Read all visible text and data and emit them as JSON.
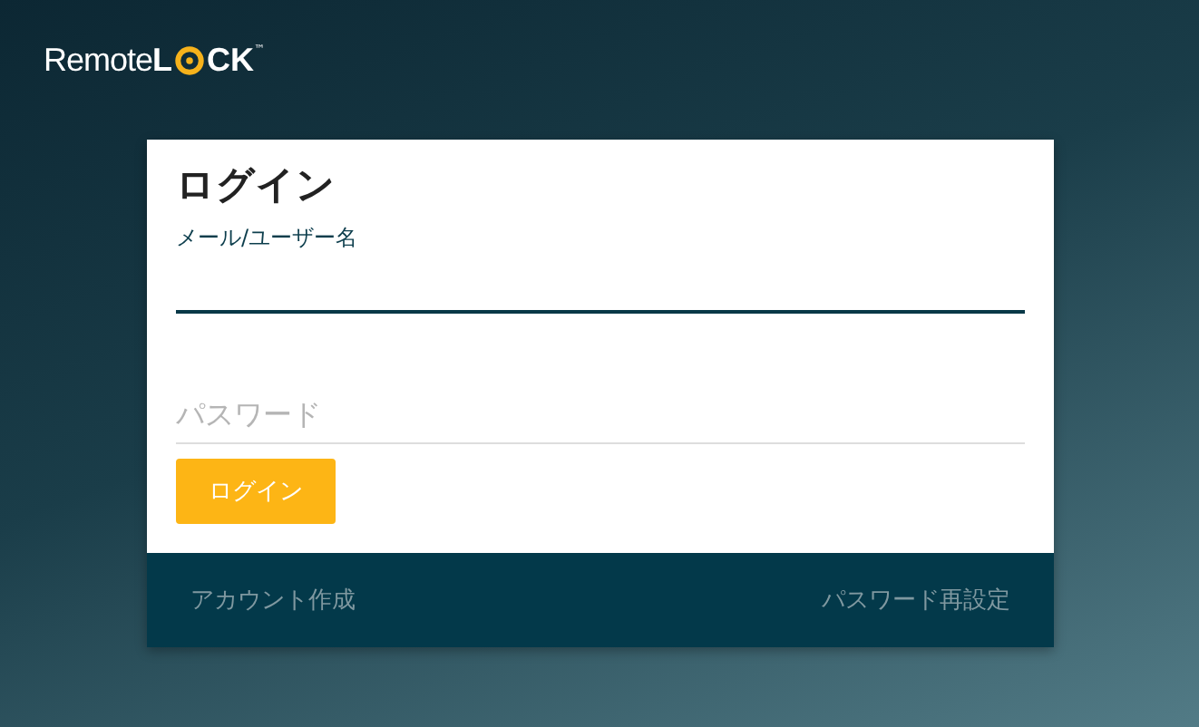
{
  "logo": {
    "word": "Remote",
    "before_icon": "L",
    "after_icon": "CK",
    "mark": "™"
  },
  "login": {
    "title": "ログイン",
    "fields": [
      {
        "label": "メール/ユーザー名",
        "focused": true
      },
      {
        "placeholder": "パスワード",
        "focused": false
      }
    ],
    "button": "ログイン"
  },
  "footer": {
    "links": [
      "アカウント作成",
      "パスワード再設定"
    ]
  }
}
